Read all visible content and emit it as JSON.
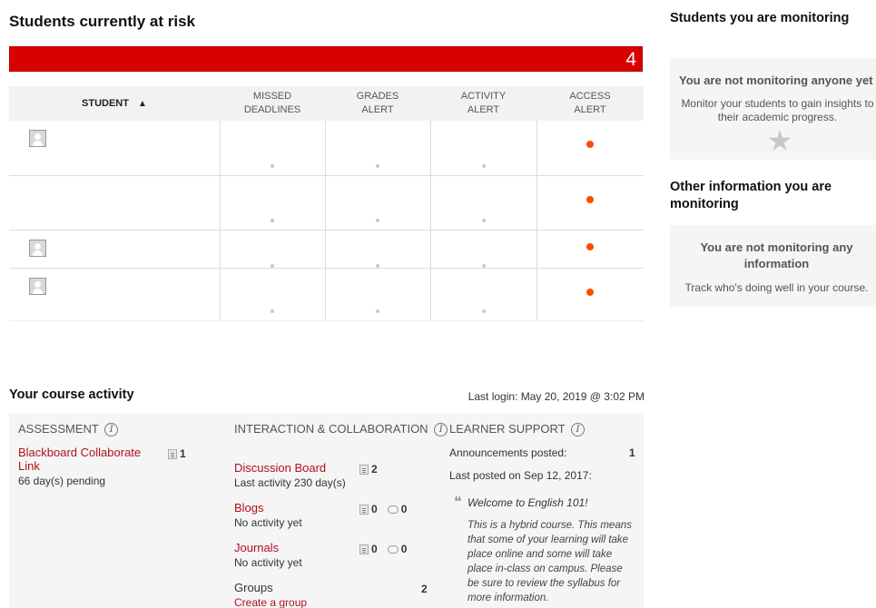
{
  "risk": {
    "title": "Students currently at risk",
    "count": "4",
    "columns": {
      "student": "STUDENT",
      "missed": [
        "MISSED",
        "DEADLINES"
      ],
      "grades": [
        "GRADES",
        "ALERT"
      ],
      "activity": [
        "ACTIVITY",
        "ALERT"
      ],
      "access": [
        "ACCESS",
        "ALERT"
      ]
    },
    "sort_indicator": "▲"
  },
  "course_activity": {
    "title": "Your course activity",
    "last_login": "Last login: May 20, 2019 @ 3:02 PM",
    "assessment": {
      "header": "ASSESSMENT",
      "item_label": "Blackboard Collaborate Link",
      "item_sub": "66 day(s) pending",
      "item_count": "1"
    },
    "interaction": {
      "header": "INTERACTION & COLLABORATION",
      "discussion": {
        "label": "Discussion Board",
        "sub": "Last activity 230 day(s)",
        "count": "2"
      },
      "blogs": {
        "label": "Blogs",
        "sub": "No activity yet",
        "posts": "0",
        "comments": "0"
      },
      "journals": {
        "label": "Journals",
        "sub": "No activity yet",
        "posts": "0",
        "comments": "0"
      },
      "groups": {
        "label": "Groups",
        "count": "2",
        "create": "Create a group"
      }
    },
    "learner_support": {
      "header": "LEARNER SUPPORT",
      "ann_posted_label": "Announcements posted:",
      "ann_posted_count": "1",
      "last_posted": "Last posted on Sep 12, 2017:",
      "quote_mark": "❝",
      "ann_title": "Welcome to English 101!",
      "ann_body": "This is a hybrid course. This means that some of your learning will take place online and some will take place in-class on campus. Please be sure to review the syllabus for more information."
    },
    "info_glyph": "i"
  },
  "sidebar": {
    "monitoring_title": "Students you are monitoring",
    "monitoring_empty_title": "You are not monitoring anyone yet",
    "monitoring_empty_text": "Monitor your students to gain insights to their academic progress.",
    "info_title": "Other information you are monitoring",
    "info_empty_title": "You are not monitoring any information",
    "info_empty_text": "Track who's doing well in your course."
  }
}
